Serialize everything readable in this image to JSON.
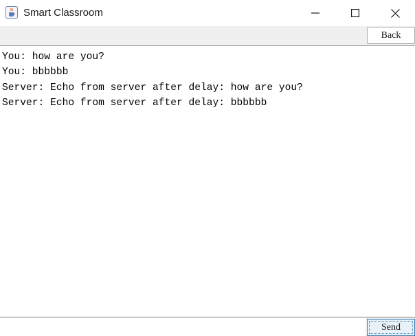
{
  "window": {
    "title": "Smart Classroom",
    "icon": "java-cup-icon",
    "controls": [
      "minimize-icon",
      "maximize-icon",
      "close-icon"
    ]
  },
  "toolbar": {
    "back_label": "Back"
  },
  "chat": {
    "lines": [
      "You: how are you?",
      "You: bbbbbb",
      "Server: Echo from server after delay: how are you?",
      "Server: Echo from server after delay: bbbbbb"
    ]
  },
  "composer": {
    "input_value": "",
    "send_label": "Send"
  },
  "colors": {
    "accent": "#3c7fb1",
    "toolbar_bg": "#f0f0f0"
  }
}
